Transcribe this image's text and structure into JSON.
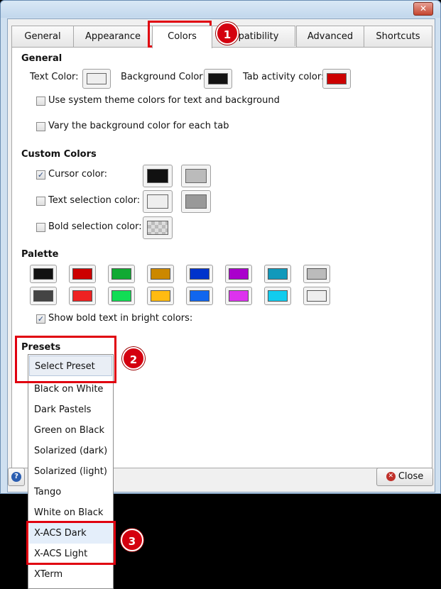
{
  "window": {
    "close_glyph": "✕"
  },
  "tabs": [
    "General",
    "Appearance",
    "Colors",
    "patibility",
    "Advanced",
    "Shortcuts"
  ],
  "general": {
    "heading": "General",
    "text_color_label": "Text Color:",
    "bg_color_label": "Background Color:",
    "tab_activity_label": "Tab activity color:",
    "text_color": "#eeeeee",
    "bg_color": "#111111",
    "tab_activity_color": "#cc0000",
    "system_theme_label": "Use system theme colors for text and background",
    "vary_bg_label": "Vary the background color for each tab"
  },
  "custom": {
    "heading": "Custom Colors",
    "cursor_label": "Cursor color:",
    "text_sel_label": "Text selection color:",
    "bold_sel_label": "Bold selection color:",
    "cursor_checked": true,
    "cursor_fg": "#111111",
    "cursor_bg": "#bbbbbb",
    "text_sel_fg": "#eeeeee",
    "text_sel_bg": "#999999"
  },
  "palette": {
    "heading": "Palette",
    "row1": [
      "#111111",
      "#cc0000",
      "#11aa33",
      "#cc8800",
      "#0033cc",
      "#aa00cc",
      "#1199bb",
      "#bbbbbb"
    ],
    "row2": [
      "#444444",
      "#ee2222",
      "#11dd55",
      "#ffbb11",
      "#1166ee",
      "#dd33ee",
      "#11ccee",
      "#eeeeee"
    ],
    "bright_bold_label": "Show bold text in bright colors:",
    "bright_bold_checked": true
  },
  "presets": {
    "heading": "Presets",
    "selected": "Select Preset",
    "options": [
      "Black on White",
      "Dark Pastels",
      "Green on Black",
      "Solarized (dark)",
      "Solarized (light)",
      "Tango",
      "White on Black",
      "X-ACS Dark",
      "X-ACS Light",
      "XTerm"
    ]
  },
  "bottom": {
    "help_glyph": "?",
    "close_label": "Close"
  },
  "annotations": [
    "1",
    "2",
    "3"
  ]
}
